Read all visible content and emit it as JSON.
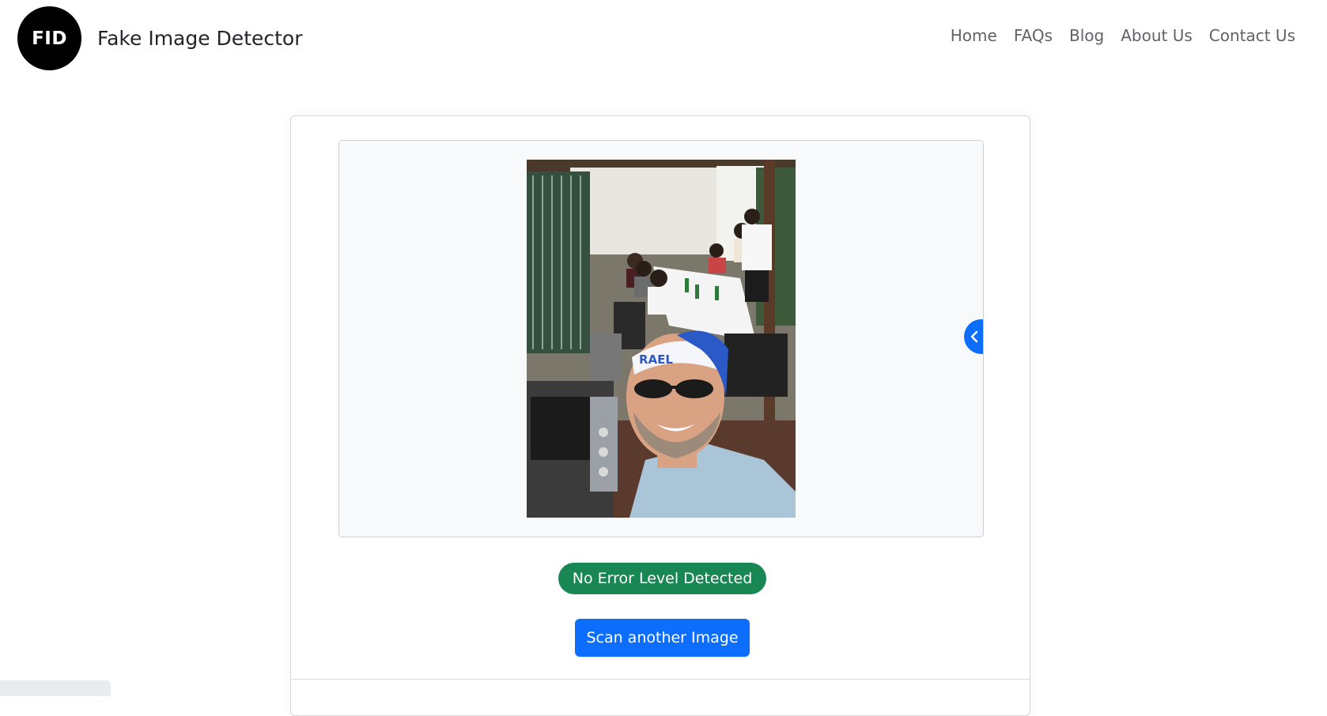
{
  "brand": {
    "logo_text": "FID",
    "name": "Fake Image Detector"
  },
  "nav": {
    "items": [
      "Home",
      "FAQs",
      "Blog",
      "About Us",
      "Contact Us"
    ]
  },
  "photo": {
    "headband_text": "RAEL"
  },
  "result": {
    "badge": "No Error Level Detected",
    "scan_button": "Scan another Image"
  },
  "colors": {
    "primary": "#0d6efd",
    "success": "#198754",
    "logo_bg": "#000000"
  },
  "icons": {
    "toggle": "chevron-left-icon"
  }
}
